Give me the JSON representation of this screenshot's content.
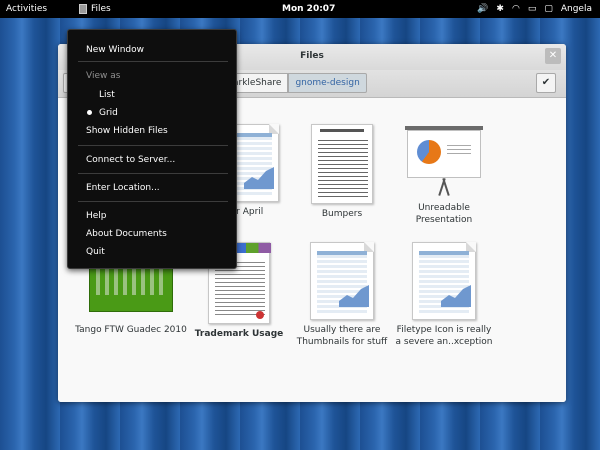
{
  "top_bar": {
    "activities": "Activities",
    "app_name": "Files",
    "clock": "Mon 20:07",
    "user": "Angela",
    "tray_icons": [
      "volume-icon",
      "bluetooth-icon",
      "wifi-icon",
      "battery-icon",
      "chat-icon"
    ]
  },
  "window": {
    "title": "Files",
    "breadcrumbs": [
      "arkleShare",
      "gnome-design"
    ],
    "active_breadcrumb": "gnome-design"
  },
  "app_menu": {
    "new_window": "New Window",
    "view_as": "View as",
    "view_list": "List",
    "view_grid": "Grid",
    "view_selected": "Grid",
    "show_hidden": "Show Hidden Files",
    "connect": "Connect to Server...",
    "enter_location": "Enter Location...",
    "help": "Help",
    "about": "About Documents",
    "quit": "Quit"
  },
  "files": [
    {
      "name": "or April",
      "type": "spreadsheet"
    },
    {
      "name": "Bumpers",
      "type": "form-document"
    },
    {
      "name": "Unreadable Presentation",
      "type": "presentation"
    },
    {
      "name": "Tango FTW Guadec 2010",
      "type": "screenshot"
    },
    {
      "name": "Trademark Usage",
      "type": "pdf-document"
    },
    {
      "name": "Usually there are\nThumbnails for stuff",
      "type": "spreadsheet"
    },
    {
      "name": "Filetype Icon is really\na severe an..xception",
      "type": "spreadsheet"
    }
  ]
}
